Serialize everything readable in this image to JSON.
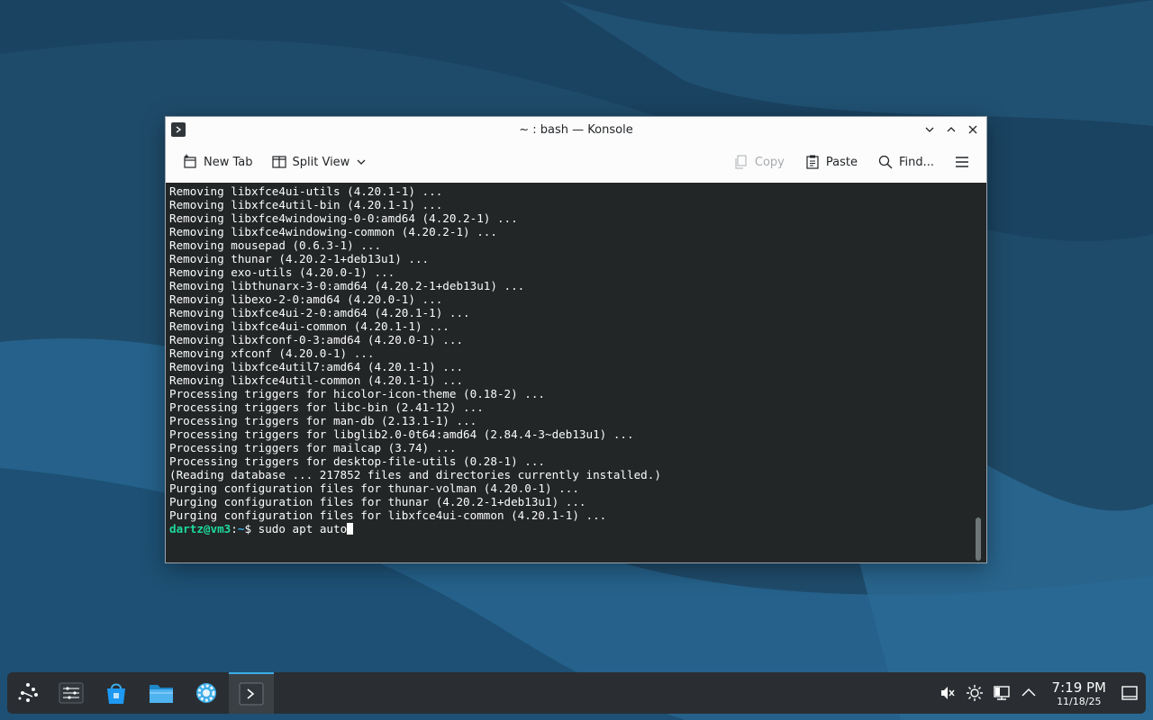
{
  "window": {
    "title": "~ : bash — Konsole"
  },
  "toolbar": {
    "new_tab": "New Tab",
    "split_view": "Split View",
    "copy": "Copy",
    "paste": "Paste",
    "find": "Find..."
  },
  "terminal": {
    "lines": [
      "Removing libxfce4ui-utils (4.20.1-1) ...",
      "Removing libxfce4util-bin (4.20.1-1) ...",
      "Removing libxfce4windowing-0-0:amd64 (4.20.2-1) ...",
      "Removing libxfce4windowing-common (4.20.2-1) ...",
      "Removing mousepad (0.6.3-1) ...",
      "Removing thunar (4.20.2-1+deb13u1) ...",
      "Removing exo-utils (4.20.0-1) ...",
      "Removing libthunarx-3-0:amd64 (4.20.2-1+deb13u1) ...",
      "Removing libexo-2-0:amd64 (4.20.0-1) ...",
      "Removing libxfce4ui-2-0:amd64 (4.20.1-1) ...",
      "Removing libxfce4ui-common (4.20.1-1) ...",
      "Removing libxfconf-0-3:amd64 (4.20.0-1) ...",
      "Removing xfconf (4.20.0-1) ...",
      "Removing libxfce4util7:amd64 (4.20.1-1) ...",
      "Removing libxfce4util-common (4.20.1-1) ...",
      "Processing triggers for hicolor-icon-theme (0.18-2) ...",
      "Processing triggers for libc-bin (2.41-12) ...",
      "Processing triggers for man-db (2.13.1-1) ...",
      "Processing triggers for libglib2.0-0t64:amd64 (2.84.4-3~deb13u1) ...",
      "Processing triggers for mailcap (3.74) ...",
      "Processing triggers for desktop-file-utils (0.28-1) ...",
      "(Reading database ... 217852 files and directories currently installed.)",
      "Purging configuration files for thunar-volman (4.20.0-1) ...",
      "Purging configuration files for thunar (4.20.2-1+deb13u1) ...",
      "Purging configuration files for libxfce4ui-common (4.20.1-1) ..."
    ],
    "prompt_user": "dartz@vm3",
    "prompt_sep": ":",
    "prompt_path": "~",
    "prompt_symbol": "$",
    "command": " sudo apt auto"
  },
  "taskbar": {
    "time": "7:19 PM",
    "date": "11/18/25"
  },
  "colors": {
    "terminal_bg": "#232627",
    "prompt_user": "#1cdc9a",
    "prompt_path": "#3daee9",
    "panel_bg": "#2a2e32"
  },
  "icons": [
    "app-menu-icon",
    "system-monitor-icon",
    "discover-store-icon",
    "dolphin-folder-icon",
    "settings-gear-icon",
    "konsole-icon",
    "volume-muted-icon",
    "brightness-icon",
    "network-icon",
    "tray-expand-icon",
    "show-desktop-icon"
  ]
}
